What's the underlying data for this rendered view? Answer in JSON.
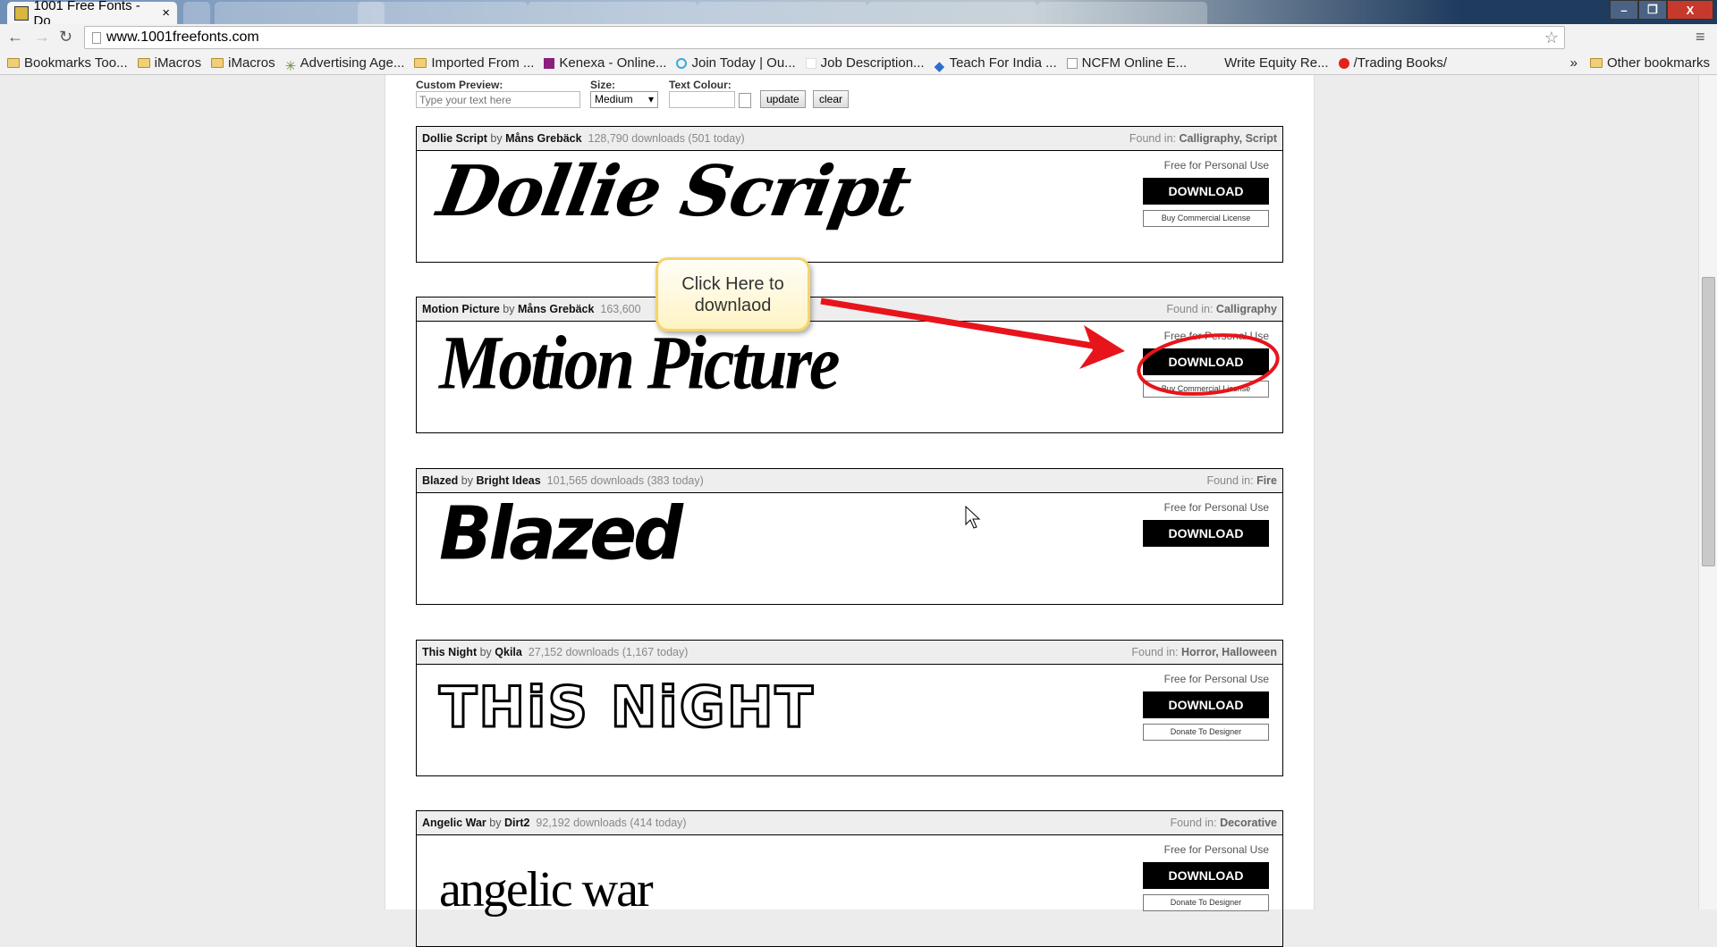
{
  "browser": {
    "tab_title": "1001 Free Fonts - Do",
    "url": "www.1001freefonts.com",
    "bookmarks": [
      "Bookmarks Too...",
      "iMacros",
      "iMacros",
      "Advertising Age...",
      "Imported From ...",
      "Kenexa - Online...",
      "Join Today | Ou...",
      "Job Description...",
      "Teach For India ...",
      "NCFM Online E...",
      "Write Equity Re...",
      "/Trading Books/"
    ],
    "overflow": "»",
    "other_bookmarks": "Other bookmarks"
  },
  "preview_form": {
    "custom_label": "Custom Preview:",
    "custom_placeholder": "Type your text here",
    "size_label": "Size:",
    "size_value": "Medium",
    "colour_label": "Text Colour:",
    "update": "update",
    "clear": "clear"
  },
  "fonts": [
    {
      "name": "Dollie Script",
      "by": "by",
      "author": "Måns Grebäck",
      "stats": "128,790 downloads (501 today)",
      "found": "Found in:",
      "cats": "Calligraphy, Script",
      "preview": "Dollie Script",
      "license": "Free for Personal Use",
      "download": "DOWNLOAD",
      "secondary": "Buy Commercial License"
    },
    {
      "name": "Motion Picture",
      "by": "by",
      "author": "Måns Grebäck",
      "stats": "163,600",
      "found": "Found in:",
      "cats": "Calligraphy",
      "preview": "Motion Picture",
      "license": "Free for Personal Use",
      "download": "DOWNLOAD",
      "secondary": "Buy Commercial License"
    },
    {
      "name": "Blazed",
      "by": "by",
      "author": "Bright Ideas",
      "stats": "101,565 downloads (383 today)",
      "found": "Found in:",
      "cats": "Fire",
      "preview": "Blazed",
      "license": "Free for Personal Use",
      "download": "DOWNLOAD",
      "secondary": ""
    },
    {
      "name": "This Night",
      "by": "by",
      "author": "Qkila",
      "stats": "27,152 downloads (1,167 today)",
      "found": "Found in:",
      "cats": "Horror, Halloween",
      "preview": "THiS NiGHT",
      "license": "Free for Personal Use",
      "download": "DOWNLOAD",
      "secondary": "Donate To Designer"
    },
    {
      "name": "Angelic War",
      "by": "by",
      "author": "Dirt2",
      "stats": "92,192 downloads (414 today)",
      "found": "Found in:",
      "cats": "Decorative",
      "preview": "angelic war",
      "license": "Free for Personal Use",
      "download": "DOWNLOAD",
      "secondary": "Donate To Designer"
    }
  ],
  "annotation": {
    "callout": "Click Here to downlaod",
    "color": "#e8141b"
  }
}
